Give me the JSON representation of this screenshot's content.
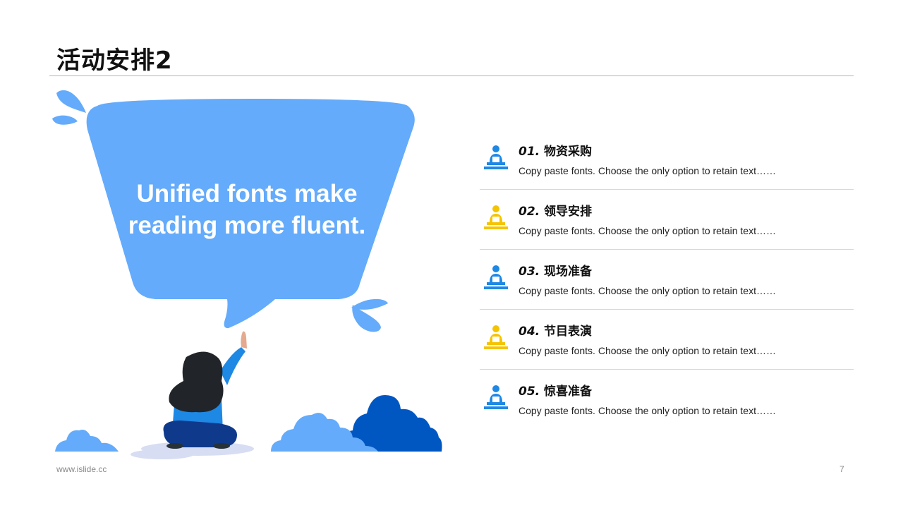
{
  "slide": {
    "title": "活动安排2",
    "bubble_text": "Unified fonts make reading more fluent.",
    "footer_url": "www.islide.cc",
    "page_number": "7"
  },
  "colors": {
    "accent_blue": "#1E88E5",
    "accent_yellow": "#F5C400",
    "bubble_blue": "#64ABFB",
    "dark_blue": "#0057C2"
  },
  "agenda": [
    {
      "number": "01.",
      "label": "物资采购",
      "desc": "Copy paste fonts. Choose the only option to retain text……",
      "icon": "speaker-podium-icon",
      "color": "#1E88E5"
    },
    {
      "number": "02.",
      "label": "领导安排",
      "desc": "Copy paste fonts. Choose the only option to retain text……",
      "icon": "speaker-podium-icon",
      "color": "#F5C400"
    },
    {
      "number": "03.",
      "label": "现场准备",
      "desc": "Copy paste fonts. Choose the only option to retain text……",
      "icon": "speaker-podium-icon",
      "color": "#1E88E5"
    },
    {
      "number": "04.",
      "label": "节目表演",
      "desc": "Copy paste fonts. Choose the only option to retain text……",
      "icon": "speaker-podium-icon",
      "color": "#F5C400"
    },
    {
      "number": "05.",
      "label": "惊喜准备",
      "desc": "Copy paste fonts. Choose the only option to retain text……",
      "icon": "speaker-podium-icon",
      "color": "#1E88E5"
    }
  ]
}
